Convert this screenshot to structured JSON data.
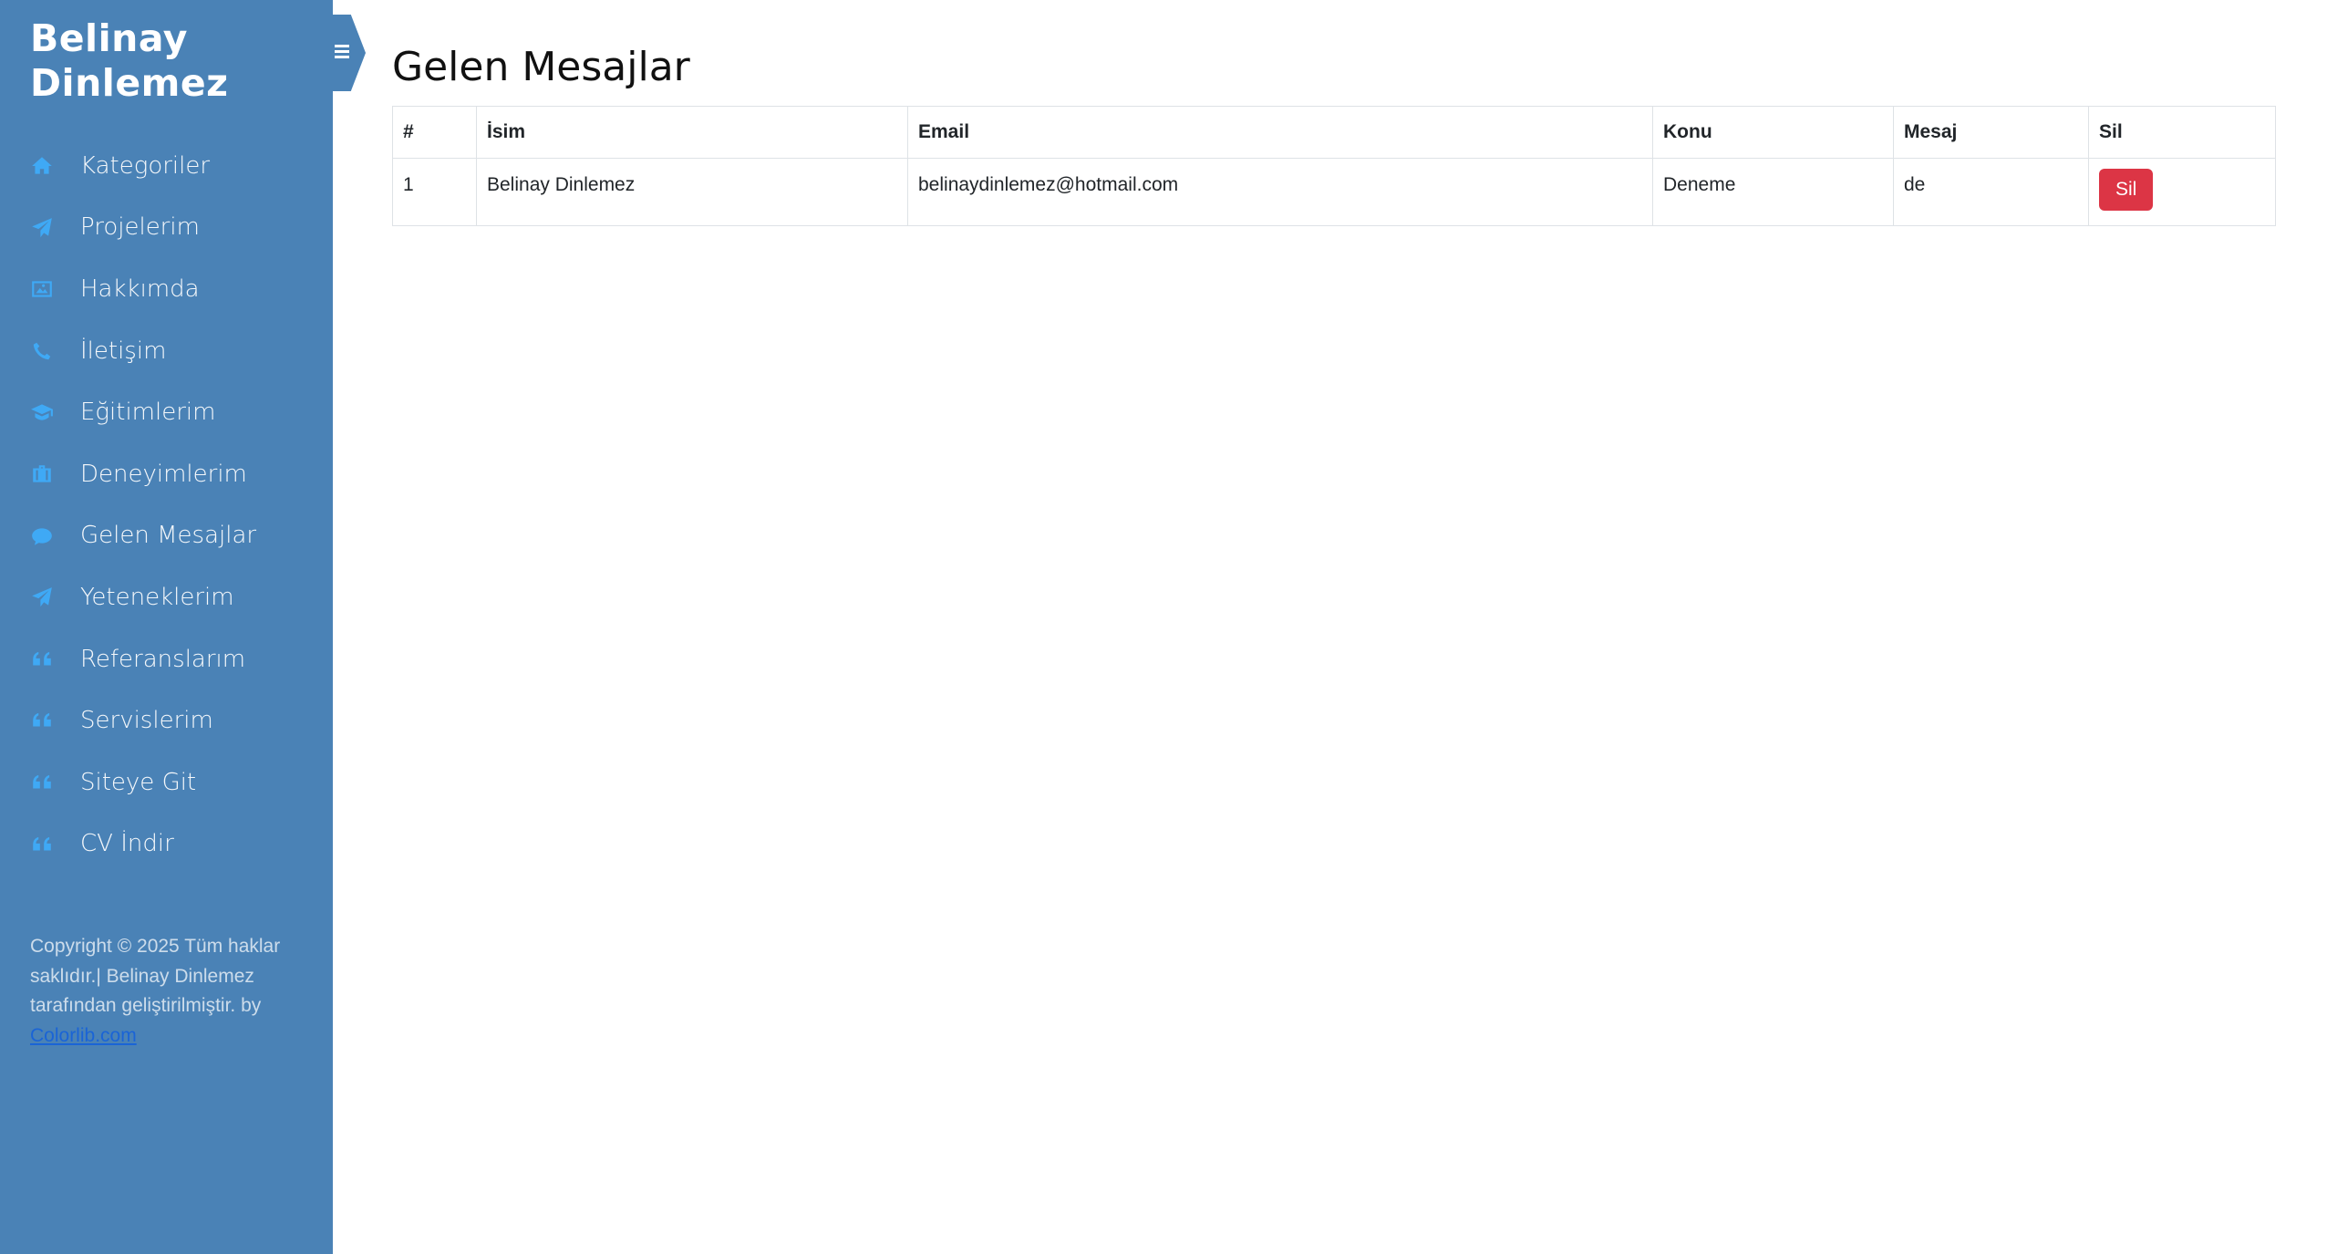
{
  "sidebar": {
    "brand": "Belinay Dinlemez",
    "items": [
      {
        "label": "Kategoriler",
        "icon": "home-icon"
      },
      {
        "label": "Projelerim",
        "icon": "paper-plane-icon"
      },
      {
        "label": "Hakkımda",
        "icon": "image-icon"
      },
      {
        "label": "İletişim",
        "icon": "phone-icon"
      },
      {
        "label": "Eğitimlerim",
        "icon": "graduation-cap-icon"
      },
      {
        "label": "Deneyimlerim",
        "icon": "briefcase-icon"
      },
      {
        "label": "Gelen Mesajlar",
        "icon": "comment-icon"
      },
      {
        "label": "Yeteneklerim",
        "icon": "paper-plane-icon"
      },
      {
        "label": "Referanslarım",
        "icon": "quote-left-icon"
      },
      {
        "label": "Servislerim",
        "icon": "quote-left-icon"
      },
      {
        "label": "Siteye Git",
        "icon": "quote-left-icon"
      },
      {
        "label": "CV İndir",
        "icon": "quote-left-icon"
      }
    ],
    "footer_text": "Copyright © 2025 Tüm haklar saklıdır.| Belinay Dinlemez tarafından geliştirilmiştir. by",
    "footer_link": "Colorlib.com"
  },
  "main": {
    "title": "Gelen Mesajlar",
    "table": {
      "headers": [
        "#",
        "İsim",
        "Email",
        "Konu",
        "Mesaj",
        "Sil"
      ],
      "rows": [
        {
          "index": "1",
          "name": "Belinay Dinlemez",
          "email": "belinaydinlemez@hotmail.com",
          "subject": "Deneme",
          "message": "de",
          "delete_label": "Sil"
        }
      ]
    }
  },
  "colors": {
    "sidebar_bg": "#4a82b6",
    "icon_accent": "#3fa9f5",
    "danger": "#dc3545"
  }
}
